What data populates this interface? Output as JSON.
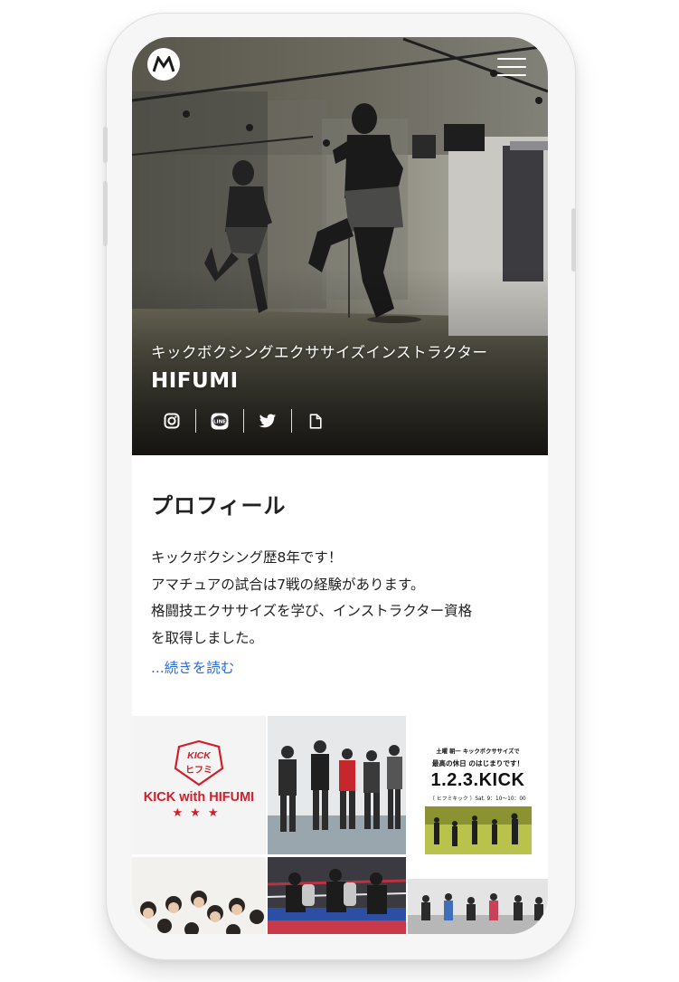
{
  "hero": {
    "subtitle": "キックボクシングエクササイズインストラクター",
    "name": "HIFUMI",
    "logo_icon": "motorola-logo-icon",
    "menu_icon": "hamburger-menu-icon",
    "social": [
      "instagram-icon",
      "line-icon",
      "twitter-icon",
      "document-icon"
    ],
    "line_label": "LINE"
  },
  "profile": {
    "heading": "プロフィール",
    "lines": [
      "キックボクシング歴8年です！",
      "アマチュアの試合は7戦の経験があります。",
      "格闘技エクササイズを学び、インストラクター資格",
      "を取得しました。"
    ],
    "read_more": "...続きを読む"
  },
  "gallery": {
    "logo_tile": {
      "badge_line1": "KICK",
      "badge_line2": "ヒフミ",
      "caption": "KICK with HIFUMI",
      "stars": "★★★"
    },
    "flyer": {
      "top": "土曜 朝一 キックボクササイズで",
      "headline": "最高の休日 のはじまりです！",
      "brand": "1.2.3.KICK",
      "sub": "〔 ヒフミキック 〕Sat. 9：10〜10：00"
    }
  },
  "colors": {
    "link": "#2a6cd8",
    "brand_red": "#d01e2a",
    "text": "#222222"
  }
}
